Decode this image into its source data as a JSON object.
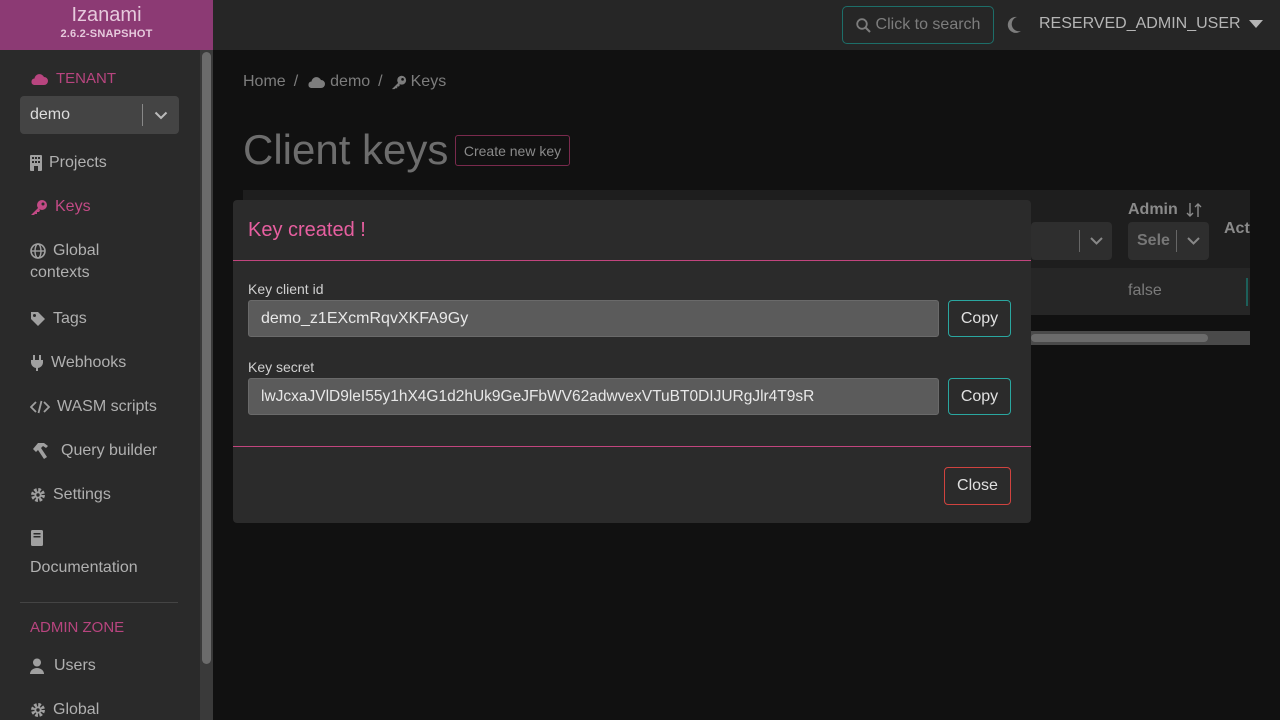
{
  "app": {
    "name": "Izanami",
    "version": "2.6.2-SNAPSHOT"
  },
  "topbar": {
    "search_label": "Click to search",
    "user": "RESERVED_ADMIN_USER"
  },
  "sidebar": {
    "tenant_label": "TENANT",
    "tenant_value": "demo",
    "items": [
      {
        "label": "Projects",
        "icon": "building-icon"
      },
      {
        "label": "Keys",
        "icon": "key-icon",
        "active": true
      },
      {
        "label": "Global",
        "label2": "contexts",
        "icon": "globe-icon"
      },
      {
        "label": "Tags",
        "icon": "tag-icon"
      },
      {
        "label": "Webhooks",
        "icon": "plug-icon"
      },
      {
        "label": "WASM scripts",
        "icon": "code-icon"
      },
      {
        "label": "Query builder",
        "icon": "hammer-icon"
      },
      {
        "label": "Settings",
        "icon": "gear-icon"
      },
      {
        "label": "Documentation",
        "icon": "book-icon"
      }
    ],
    "admin_zone_label": "ADMIN ZONE",
    "admin_items": [
      {
        "label": "Users",
        "icon": "user-icon"
      },
      {
        "label": "Global",
        "icon": "gear-icon"
      }
    ]
  },
  "breadcrumb": {
    "home": "Home",
    "sep": "/",
    "tenant": "demo",
    "page": "Keys"
  },
  "main": {
    "title": "Client keys",
    "create_button": "Create new key",
    "table": {
      "admin_header": "Admin",
      "actions_header_partial": "Act",
      "admin_filter": "Sele",
      "row_admin_value": "false"
    }
  },
  "modal": {
    "title": "Key created !",
    "client_id_label": "Key client id",
    "client_id_value": "demo_z1EXcmRqvXKFA9Gy",
    "secret_label": "Key secret",
    "secret_value": "lwJcxaJVlD9leI55y1hX4G1d2hUk9GeJFbWV62adwvexVTuBT0DIJURgJlr4T9sR",
    "copy_label": "Copy",
    "close_label": "Close"
  },
  "colors": {
    "accent": "#c24a85",
    "brand_bg": "#8c3a74",
    "teal": "#2aa7a0",
    "danger": "#d0433f"
  }
}
